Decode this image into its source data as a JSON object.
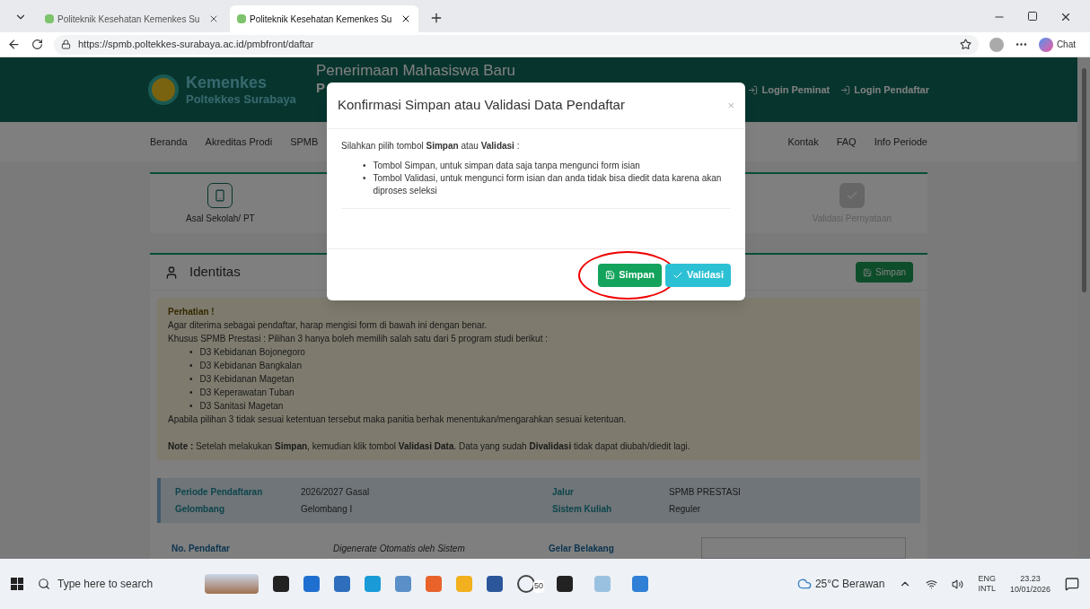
{
  "browser": {
    "tabs": [
      {
        "title": "Politeknik Kesehatan Kemenkes Su",
        "selected": false
      },
      {
        "title": "Politeknik Kesehatan Kemenkes Su",
        "selected": true
      }
    ],
    "url": "https://spmb.poltekkes-surabaya.ac.id/pmbfront/daftar",
    "profile_button": "Chat"
  },
  "header": {
    "brand": "Kemenkes",
    "brand_sub": "Poltekkes Surabaya",
    "title": "Penerimaan Mahasiswa Baru",
    "subtitle": "P",
    "logins": [
      "Login Peminat",
      "Login Pendaftar"
    ]
  },
  "nav": [
    "Beranda",
    "Akreditas Prodi",
    "SPMB",
    "Kontak",
    "FAQ",
    "Info Periode"
  ],
  "steps": [
    {
      "label": "Asal Sekolah/ PT",
      "active": true
    },
    {
      "label": "Validasi Pernyataan",
      "active": false
    }
  ],
  "identitas": {
    "title": "Identitas",
    "save_button": "Simpan",
    "alert": {
      "heading": "Perhatian !",
      "bullet": "•",
      "lines": [
        "Agar diterima sebagai pendaftar, harap mengisi form di bawah ini dengan benar.",
        "Khusus SPMB Prestasi : Pilihan 3 hanya boleh memilih salah satu dari 5 program studi berikut :"
      ],
      "programs": [
        "D3 Kebidanan Bojonegoro",
        "D3 Kebidanan Bangkalan",
        "D3 Kebidanan Magetan",
        "D3 Keperawatan Tuban",
        "D3 Sanitasi Magetan"
      ],
      "after": "Apabila pilihan 3 tidak sesuai ketentuan tersebut maka panitia berhak menentukan/mengarahkan sesuai ketentuan.",
      "note": "**Note :** Setelah melakukan **Simpan**, kemudian klik tombol **Validasi Data**. Data yang sudah **Divalidasi** tidak dapat diubah/diedit lagi."
    },
    "info": [
      {
        "label": "Periode Pendaftaran",
        "value": "2026/2027 Gasal",
        "label2": "Jalur",
        "value2": "SPMB PRESTASI"
      },
      {
        "label": "Gelombang",
        "value": "Gelombang I",
        "label2": "Sistem Kuliah",
        "value2": "Reguler"
      }
    ],
    "form_row": {
      "label": "No. Pendaftar",
      "value": "Digenerate Otomatis oleh Sistem",
      "label2": "Gelar Belakang"
    }
  },
  "modal": {
    "title": "Konfirmasi Simpan atau Validasi Data Pendaftar",
    "close": "×",
    "intro": "Silahkan pilih tombol **Simpan** atau **Validasi** :",
    "bullet": "•",
    "bullets": [
      "Tombol Simpan, untuk simpan data saja tanpa mengunci form isian",
      "Tombol Validasi, untuk mengunci form isian dan anda tidak bisa diedit data karena akan diproses seleksi"
    ],
    "buttons": [
      {
        "label": "Simpan",
        "kind": "save",
        "circled": true
      },
      {
        "label": "Validasi",
        "kind": "validate",
        "circled": false
      }
    ]
  },
  "taskbar": {
    "search": "Type here to search",
    "badge": "50",
    "weather": "25°C Berawan",
    "lang": "ENG",
    "lang_sub": "INTL",
    "time": "23.23",
    "date": "10/01/2026"
  }
}
